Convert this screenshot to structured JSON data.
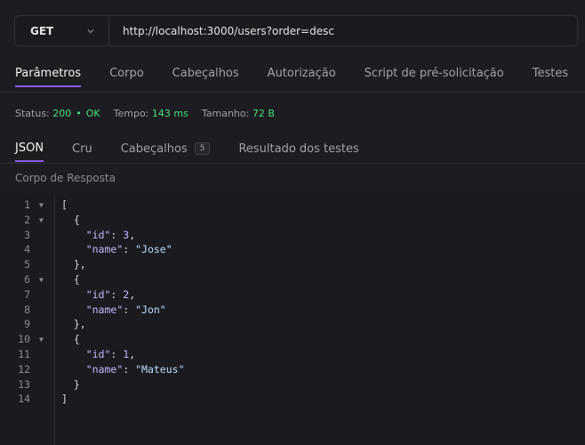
{
  "request": {
    "method": "GET",
    "url": "http://localhost:3000/users?order=desc"
  },
  "request_tabs": [
    {
      "label": "Parâmetros",
      "active": true
    },
    {
      "label": "Corpo",
      "active": false
    },
    {
      "label": "Cabeçalhos",
      "active": false
    },
    {
      "label": "Autorização",
      "active": false
    },
    {
      "label": "Script de pré-solicitação",
      "active": false
    },
    {
      "label": "Testes",
      "active": false
    }
  ],
  "status": {
    "status_label": "Status:",
    "status_code": "200",
    "status_text": "OK",
    "time_label": "Tempo:",
    "time_value": "143 ms",
    "size_label": "Tamanho:",
    "size_value": "72 B"
  },
  "response_tabs": [
    {
      "label": "JSON",
      "active": true
    },
    {
      "label": "Cru",
      "active": false
    },
    {
      "label": "Cabeçalhos",
      "active": false,
      "badge": "5"
    },
    {
      "label": "Resultado dos testes",
      "active": false
    }
  ],
  "response_body_label": "Corpo de Resposta",
  "code_lines": [
    {
      "n": "1",
      "fold": true,
      "tokens": [
        [
          "punc",
          "["
        ]
      ]
    },
    {
      "n": "2",
      "fold": true,
      "tokens": [
        [
          "punc",
          "  {"
        ]
      ]
    },
    {
      "n": "3",
      "fold": false,
      "tokens": [
        [
          "punc",
          "    "
        ],
        [
          "key",
          "\"id\""
        ],
        [
          "punc",
          ": "
        ],
        [
          "num",
          "3"
        ],
        [
          "punc",
          ","
        ]
      ]
    },
    {
      "n": "4",
      "fold": false,
      "tokens": [
        [
          "punc",
          "    "
        ],
        [
          "key",
          "\"name\""
        ],
        [
          "punc",
          ": "
        ],
        [
          "str",
          "\"Jose\""
        ]
      ]
    },
    {
      "n": "5",
      "fold": false,
      "tokens": [
        [
          "punc",
          "  },"
        ]
      ]
    },
    {
      "n": "6",
      "fold": true,
      "tokens": [
        [
          "punc",
          "  {"
        ]
      ]
    },
    {
      "n": "7",
      "fold": false,
      "tokens": [
        [
          "punc",
          "    "
        ],
        [
          "key",
          "\"id\""
        ],
        [
          "punc",
          ": "
        ],
        [
          "num",
          "2"
        ],
        [
          "punc",
          ","
        ]
      ]
    },
    {
      "n": "8",
      "fold": false,
      "tokens": [
        [
          "punc",
          "    "
        ],
        [
          "key",
          "\"name\""
        ],
        [
          "punc",
          ": "
        ],
        [
          "str",
          "\"Jon\""
        ]
      ]
    },
    {
      "n": "9",
      "fold": false,
      "tokens": [
        [
          "punc",
          "  },"
        ]
      ]
    },
    {
      "n": "10",
      "fold": true,
      "tokens": [
        [
          "punc",
          "  {"
        ]
      ]
    },
    {
      "n": "11",
      "fold": false,
      "tokens": [
        [
          "punc",
          "    "
        ],
        [
          "key",
          "\"id\""
        ],
        [
          "punc",
          ": "
        ],
        [
          "num",
          "1"
        ],
        [
          "punc",
          ","
        ]
      ]
    },
    {
      "n": "12",
      "fold": false,
      "tokens": [
        [
          "punc",
          "    "
        ],
        [
          "key",
          "\"name\""
        ],
        [
          "punc",
          ": "
        ],
        [
          "str",
          "\"Mateus\""
        ]
      ]
    },
    {
      "n": "13",
      "fold": false,
      "tokens": [
        [
          "punc",
          "  }"
        ]
      ]
    },
    {
      "n": "14",
      "fold": false,
      "tokens": [
        [
          "punc",
          "]"
        ]
      ]
    }
  ],
  "icons": {
    "method_dropdown": "chevron-down-icon",
    "fold_marker": "fold-arrow-icon"
  },
  "colors": {
    "accent": "#8b5cf6",
    "status_ok": "#4ade80",
    "json_key": "#c4b5fd",
    "json_string": "#bfdbfe"
  }
}
